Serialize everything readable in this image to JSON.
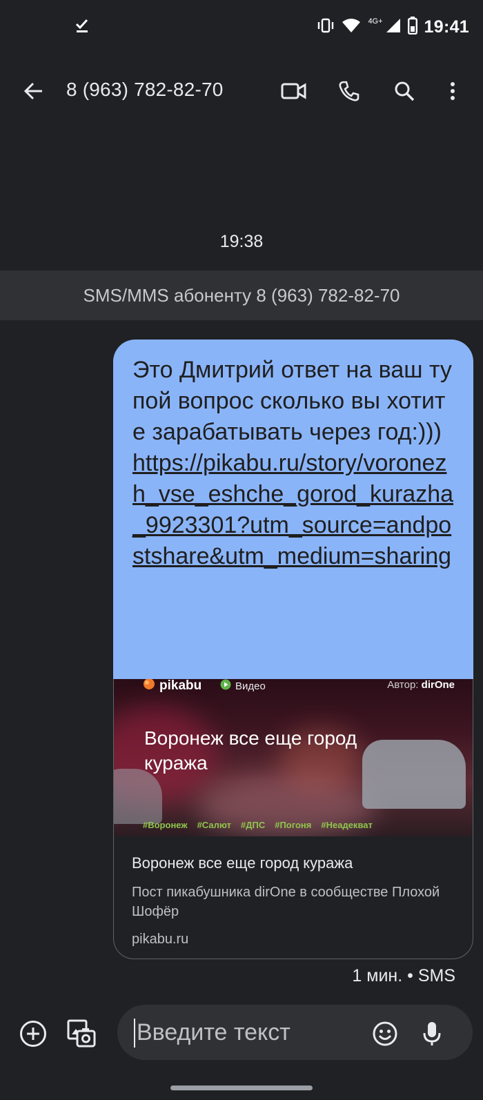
{
  "status_bar": {
    "time": "19:41",
    "network_label": "4G+",
    "icons": [
      "download-done-icon",
      "vibrate-icon",
      "wifi-icon",
      "signal-icon",
      "battery-icon"
    ]
  },
  "app_bar": {
    "title": "8 (963) 782-82-70",
    "icons": [
      "back-arrow-icon",
      "video-call-icon",
      "phone-icon",
      "search-icon",
      "more-vert-icon"
    ]
  },
  "conversation": {
    "timestamp": "19:38",
    "sms_banner": "SMS/MMS абоненту 8 (963) 782-82-70"
  },
  "message": {
    "text": "Это Дмитрий ответ на ваш тупой вопрос сколько вы хотите зарабатывать через год:))) ",
    "link": "https://pikabu.ru/story/voronezh_vse_eshche_gorod_kurazha_9923301?utm_source=andpostshare&utm_medium=sharing",
    "meta": "1 мин. • SMS"
  },
  "link_preview": {
    "image": {
      "brand": "pikabu",
      "video_label": "Видео",
      "author_prefix": "Автор:",
      "author": "dirOne",
      "headline": "Воронеж все еще город куража",
      "hashtags": [
        "#Воронеж",
        "#Салют",
        "#ДПС",
        "#Погоня",
        "#Неадекват"
      ]
    },
    "title": "Воронеж все еще город куража",
    "description": "Пост пикабушника dirOne в сообществе Плохой Шофёр",
    "domain": "pikabu.ru"
  },
  "compose": {
    "placeholder": "Введите текст",
    "icons": [
      "add-circle-icon",
      "gallery-icon",
      "emoji-icon",
      "mic-icon"
    ]
  },
  "colors": {
    "background": "#202124",
    "banner": "#303134",
    "bubble": "#8ab4f8",
    "hashtag": "#8fc54c"
  }
}
